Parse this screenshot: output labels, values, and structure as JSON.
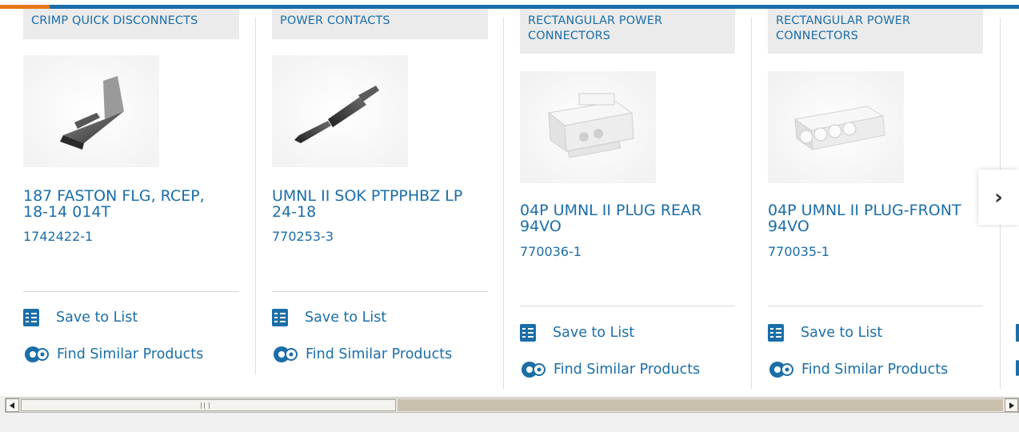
{
  "products": [
    {
      "category": "CRIMP QUICK DISCONNECTS",
      "title": "187 FASTON FLG, RCEP, 18-14 014T",
      "part_number": "1742422-1",
      "save_label": "Save to List",
      "similar_label": "Find Similar Products"
    },
    {
      "category": "POWER CONTACTS",
      "title": "UMNL II SOK PTPPHBZ LP 24-18",
      "part_number": "770253-3",
      "save_label": "Save to List",
      "similar_label": "Find Similar Products"
    },
    {
      "category": "RECTANGULAR POWER CONNECTORS",
      "title": "04P UMNL II PLUG REAR 94VO",
      "part_number": "770036-1",
      "save_label": "Save to List",
      "similar_label": "Find Similar Products"
    },
    {
      "category": "RECTANGULAR POWER CONNECTORS",
      "title": "04P UMNL II PLUG-FRONT 94VO",
      "part_number": "770035-1",
      "save_label": "Save to List",
      "similar_label": "Find Similar Products"
    }
  ],
  "carousel": {
    "next_icon": "chevron-right-icon",
    "next_glyph": "›"
  },
  "colors": {
    "link": "#1b6ea8",
    "accent": "#e77817",
    "category_bg": "#ebebeb"
  },
  "icons": {
    "save": "checklist-icon",
    "similar": "gears-icon"
  }
}
